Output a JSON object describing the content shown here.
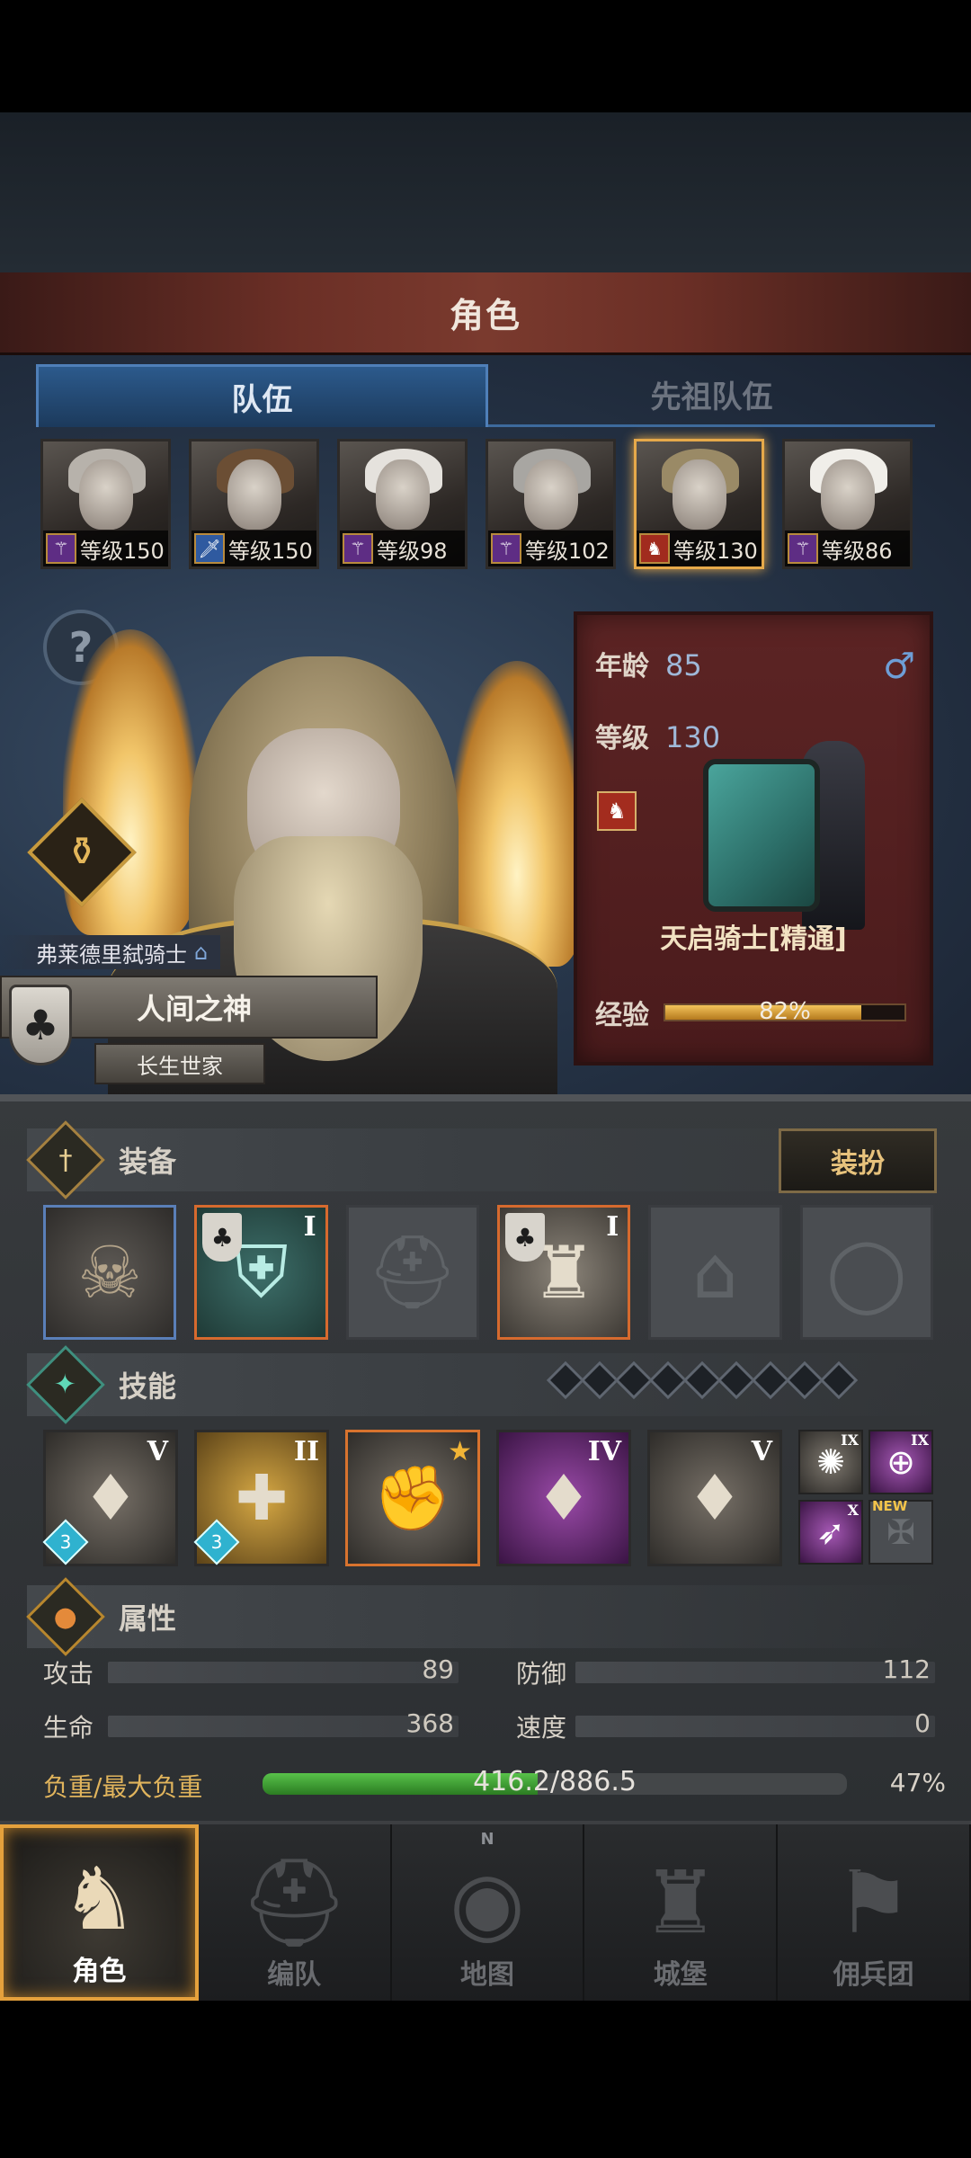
{
  "screen_title": "角色",
  "tabs": [
    {
      "label": "队伍",
      "active": true
    },
    {
      "label": "先祖队伍",
      "active": false
    }
  ],
  "party": [
    {
      "level_label": "等级150",
      "class_icon": "staff-icon"
    },
    {
      "level_label": "等级150",
      "class_icon": "sword-icon"
    },
    {
      "level_label": "等级98",
      "class_icon": "staff-icon"
    },
    {
      "level_label": "等级102",
      "class_icon": "staff-icon"
    },
    {
      "level_label": "等级130",
      "class_icon": "horse-icon",
      "selected": true
    },
    {
      "level_label": "等级86",
      "class_icon": "staff-icon"
    }
  ],
  "hero": {
    "house_title": "弗莱德里弑骑士",
    "name": "人间之神",
    "house": "长生世家"
  },
  "info": {
    "age_label": "年龄",
    "age_value": "85",
    "level_label": "等级",
    "level_value": "130",
    "class_name": "天启骑士[精通]",
    "exp_label": "经验",
    "exp_percent": "82%",
    "exp_fraction": 0.82,
    "gender_icon": "male-icon"
  },
  "equipment": {
    "title": "装备",
    "dress_button": "装扮",
    "slots": [
      {
        "name": "weapon-slot",
        "rank": ""
      },
      {
        "name": "shield-slot",
        "rank": "I"
      },
      {
        "name": "helmet-slot",
        "rank": ""
      },
      {
        "name": "armor-slot",
        "rank": "I"
      },
      {
        "name": "boots-slot",
        "rank": ""
      },
      {
        "name": "ring-slot",
        "rank": ""
      }
    ]
  },
  "skills": {
    "title": "技能",
    "items": [
      {
        "rank": "V",
        "gem": "3"
      },
      {
        "rank": "II",
        "gem": "3"
      },
      {
        "rank": ""
      },
      {
        "rank": "IV"
      },
      {
        "rank": "V"
      }
    ],
    "mini": [
      {
        "rank": "IX"
      },
      {
        "rank": "IX"
      },
      {
        "rank": "X"
      },
      {
        "badge": "NEW"
      }
    ]
  },
  "attributes": {
    "title": "属性",
    "attack_label": "攻击",
    "attack_value": "89",
    "defense_label": "防御",
    "defense_value": "112",
    "hp_label": "生命",
    "hp_value": "368",
    "speed_label": "速度",
    "speed_value": "0",
    "load_label": "负重/最大负重",
    "load_value": "416.2/886.5",
    "load_percent": "47%",
    "load_fraction": 0.47
  },
  "bottom_nav": [
    {
      "label": "角色",
      "active": true
    },
    {
      "label": "编队",
      "active": false
    },
    {
      "label": "地图",
      "active": false,
      "compass": "N"
    },
    {
      "label": "城堡",
      "active": false
    },
    {
      "label": "佣兵团",
      "active": false
    }
  ]
}
